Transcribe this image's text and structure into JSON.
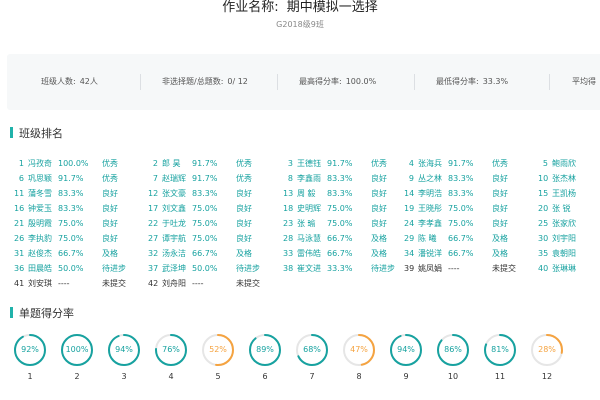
{
  "header": {
    "title_label": "作业名称:",
    "title_value": "期中模拟一选择",
    "class_name": "G2018级9班"
  },
  "stats": [
    {
      "label": "班级人数:",
      "value": "42人"
    },
    {
      "label": "非选择题/总题数:",
      "value": "0/ 12"
    },
    {
      "label": "最高得分率:",
      "value": "100.0%"
    },
    {
      "label": "最低得分率:",
      "value": "33.3%"
    },
    {
      "label": "平均得",
      "value": ""
    }
  ],
  "ranking_title": "班级排名",
  "ranking": [
    [
      {
        "rank": "1",
        "name": "冯孜奇",
        "score": "100.0%",
        "grade": "优秀"
      },
      {
        "rank": "6",
        "name": "巩思颖",
        "score": "91.7%",
        "grade": "优秀"
      },
      {
        "rank": "11",
        "name": "蒲冬雪",
        "score": "83.3%",
        "grade": "良好"
      },
      {
        "rank": "16",
        "name": "钟爱玉",
        "score": "83.3%",
        "grade": "良好"
      },
      {
        "rank": "21",
        "name": "殷明霞",
        "score": "75.0%",
        "grade": "良好"
      },
      {
        "rank": "26",
        "name": "李执豹",
        "score": "75.0%",
        "grade": "良好"
      },
      {
        "rank": "31",
        "name": "赵俊杰",
        "score": "66.7%",
        "grade": "及格"
      },
      {
        "rank": "36",
        "name": "田晨皓",
        "score": "50.0%",
        "grade": "待进步"
      },
      {
        "rank": "41",
        "name": "刘安琪",
        "score": "----",
        "grade": "未提交"
      }
    ],
    [
      {
        "rank": "2",
        "name": "郎 昊",
        "score": "91.7%",
        "grade": "优秀"
      },
      {
        "rank": "7",
        "name": "赵瑞辉",
        "score": "91.7%",
        "grade": "优秀"
      },
      {
        "rank": "12",
        "name": "张文豪",
        "score": "83.3%",
        "grade": "良好"
      },
      {
        "rank": "17",
        "name": "刘文鑫",
        "score": "75.0%",
        "grade": "良好"
      },
      {
        "rank": "22",
        "name": "于吐龙",
        "score": "75.0%",
        "grade": "良好"
      },
      {
        "rank": "27",
        "name": "谭宇航",
        "score": "75.0%",
        "grade": "良好"
      },
      {
        "rank": "32",
        "name": "汤永洁",
        "score": "66.7%",
        "grade": "及格"
      },
      {
        "rank": "37",
        "name": "武泽坤",
        "score": "50.0%",
        "grade": "待进步"
      },
      {
        "rank": "42",
        "name": "刘舟阳",
        "score": "----",
        "grade": "未提交"
      }
    ],
    [
      {
        "rank": "3",
        "name": "王德钰",
        "score": "91.7%",
        "grade": "优秀"
      },
      {
        "rank": "8",
        "name": "李鑫雨",
        "score": "83.3%",
        "grade": "良好"
      },
      {
        "rank": "13",
        "name": "周 毅",
        "score": "83.3%",
        "grade": "良好"
      },
      {
        "rank": "18",
        "name": "史明辉",
        "score": "75.0%",
        "grade": "良好"
      },
      {
        "rank": "23",
        "name": "张 瑜",
        "score": "75.0%",
        "grade": "良好"
      },
      {
        "rank": "28",
        "name": "马泳慧",
        "score": "66.7%",
        "grade": "及格"
      },
      {
        "rank": "33",
        "name": "雷伟皓",
        "score": "66.7%",
        "grade": "及格"
      },
      {
        "rank": "38",
        "name": "崔文进",
        "score": "33.3%",
        "grade": "待进步"
      }
    ],
    [
      {
        "rank": "4",
        "name": "张海兵",
        "score": "91.7%",
        "grade": "优秀"
      },
      {
        "rank": "9",
        "name": "丛之林",
        "score": "83.3%",
        "grade": "良好"
      },
      {
        "rank": "14",
        "name": "李明浩",
        "score": "83.3%",
        "grade": "良好"
      },
      {
        "rank": "19",
        "name": "王晓彤",
        "score": "75.0%",
        "grade": "良好"
      },
      {
        "rank": "24",
        "name": "李孝鑫",
        "score": "75.0%",
        "grade": "良好"
      },
      {
        "rank": "29",
        "name": "陈 曦",
        "score": "66.7%",
        "grade": "及格"
      },
      {
        "rank": "34",
        "name": "潘锐洋",
        "score": "66.7%",
        "grade": "及格"
      },
      {
        "rank": "39",
        "name": "姚凤娟",
        "score": "----",
        "grade": "未提交"
      }
    ],
    [
      {
        "rank": "5",
        "name": "鲍雨欣"
      },
      {
        "rank": "10",
        "name": "张杰林"
      },
      {
        "rank": "15",
        "name": "王凯杨"
      },
      {
        "rank": "20",
        "name": "张 锐"
      },
      {
        "rank": "25",
        "name": "张家欣"
      },
      {
        "rank": "30",
        "name": "刘宇阳"
      },
      {
        "rank": "35",
        "name": "袁朝阳"
      },
      {
        "rank": "40",
        "name": "张琳琳"
      }
    ]
  ],
  "scores_title": "单题得分率",
  "question_scores": [
    {
      "num": "1",
      "pct": 92,
      "label": "92%"
    },
    {
      "num": "2",
      "pct": 100,
      "label": "100%"
    },
    {
      "num": "3",
      "pct": 94,
      "label": "94%"
    },
    {
      "num": "4",
      "pct": 76,
      "label": "76%"
    },
    {
      "num": "5",
      "pct": 52,
      "label": "52%"
    },
    {
      "num": "6",
      "pct": 89,
      "label": "89%"
    },
    {
      "num": "7",
      "pct": 68,
      "label": "68%"
    },
    {
      "num": "8",
      "pct": 47,
      "label": "47%"
    },
    {
      "num": "9",
      "pct": 94,
      "label": "94%"
    },
    {
      "num": "10",
      "pct": 86,
      "label": "86%"
    },
    {
      "num": "11",
      "pct": 81,
      "label": "81%"
    },
    {
      "num": "12",
      "pct": 28,
      "label": "28%"
    }
  ],
  "colors": {
    "teal": "#17a2a0",
    "orange": "#f5a340",
    "track": "#e6e6e6",
    "accent_bar": "#20b2aa"
  }
}
